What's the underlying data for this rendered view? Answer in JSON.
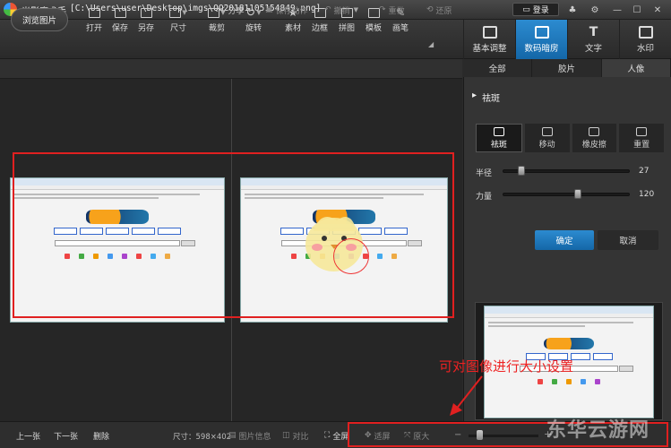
{
  "app": {
    "title": "光影魔术手",
    "file_path": "[C:\\Users\\user\\Desktop\\imgs\\QQ20181105154849.png]",
    "login": "登录"
  },
  "toolbar": {
    "browse": "浏览图片",
    "tools": [
      "打开",
      "保存",
      "另存",
      "尺寸",
      "裁剪",
      "旋转",
      "素材",
      "边框",
      "拼图",
      "模板",
      "画笔"
    ]
  },
  "right_tabs": [
    "基本调整",
    "数码暗房",
    "文字",
    "水印"
  ],
  "subbar": {
    "share": "分享",
    "save_action": "保存动作",
    "undo": "撤销",
    "redo": "重做",
    "restore": "还原"
  },
  "panel": {
    "tabs": [
      "全部",
      "胶片",
      "人像"
    ],
    "section_title": "祛斑",
    "modes": [
      "祛斑",
      "移动",
      "橡皮擦",
      "重置"
    ],
    "radius_label": "半径",
    "radius_value": "27",
    "radius_level": 0.12,
    "strength_label": "力量",
    "strength_value": "120",
    "strength_level": 0.6,
    "ok": "确定",
    "cancel": "取消"
  },
  "annotation": "可对图像进行大小设置",
  "bottom": {
    "prev": "上一张",
    "next": "下一张",
    "delete": "删除",
    "dimensions": "尺寸：598×402",
    "info": "图片信息",
    "compare": "对比",
    "fullscreen": "全屏",
    "fit": "适屏",
    "original": "原大"
  },
  "watermark": "东华云游网",
  "colors": {
    "accent": "#1a78c2",
    "annotation": "#e02020"
  }
}
